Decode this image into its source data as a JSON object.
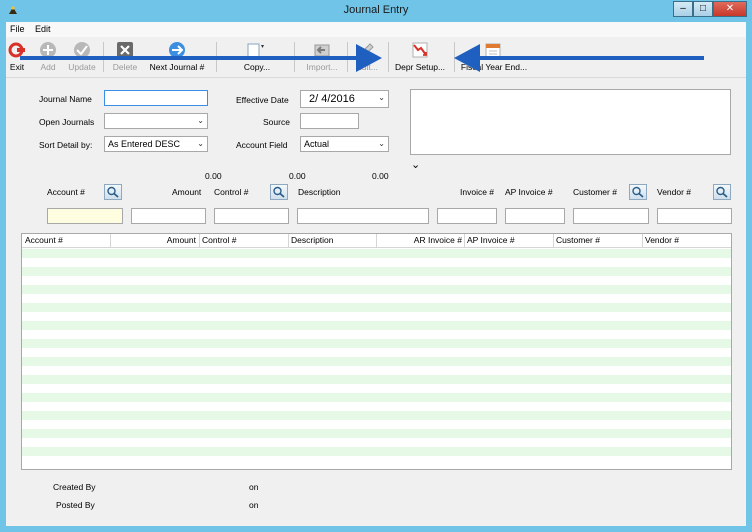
{
  "window": {
    "title": "Journal Entry",
    "min_glyph": "–",
    "max_glyph": "□",
    "close_glyph": "✕"
  },
  "menu": [
    "File",
    "Edit"
  ],
  "toolbar": {
    "exit": "Exit",
    "add": "Add",
    "update": "Update",
    "delete": "Delete",
    "next_journal": "Next Journal #",
    "copy": "Copy...",
    "import": "Import...",
    "edit": "Edit...",
    "depr_setup": "Depr Setup...",
    "fiscal_year_end": "Fiscal Year End..."
  },
  "form": {
    "journal_name_label": "Journal Name",
    "journal_name_value": "",
    "open_journals_label": "Open Journals",
    "open_journals_value": "",
    "sort_detail_label": "Sort Detail by:",
    "sort_detail_value": "As Entered DESC",
    "effective_date_label": "Effective Date",
    "effective_date_value": "2/  4/2016",
    "source_label": "Source",
    "source_value": "",
    "account_field_label": "Account Field",
    "account_field_value": "Actual",
    "expand_glyph": "⌵"
  },
  "entry": {
    "account_label": "Account #",
    "amount_label": "Amount",
    "control_label": "Control #",
    "description_label": "Description",
    "invoice_label": "Invoice #",
    "ap_invoice_label": "AP Invoice #",
    "customer_label": "Customer #",
    "vendor_label": "Vendor #",
    "total_1": "0.00",
    "total_2": "0.00",
    "total_3": "0.00"
  },
  "grid": {
    "columns": [
      "Account #",
      "Amount",
      "Control #",
      "Description",
      "AR Invoice #",
      "AP Invoice #",
      "Customer #",
      "Vendor #"
    ]
  },
  "footer": {
    "created_by_label": "Created By",
    "created_on_label": "on",
    "posted_by_label": "Posted By",
    "posted_on_label": "on"
  },
  "colors": {
    "arrow": "#1f5fbf",
    "titlebar": "#6fc4e8",
    "grid_alt_row": "#e6f8e6",
    "highlight_field": "#fffde0"
  }
}
